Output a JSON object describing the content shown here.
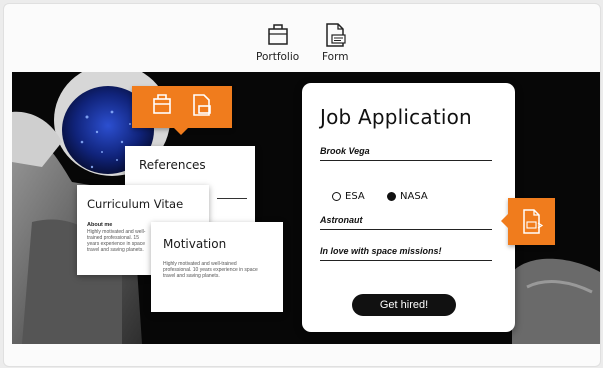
{
  "toolbar": {
    "portfolio_label": "Portfolio",
    "form_label": "Form"
  },
  "references": {
    "title": "References"
  },
  "cv": {
    "title": "Curriculum Vitae",
    "about_heading": "About me",
    "about_text": "Highly motivated and well-trained professional. 15 years experience in space travel and saving planets."
  },
  "motivation": {
    "title": "Motivation",
    "text": "Highly motivated and well-trained professional. 10 years experience in space travel and saving planets."
  },
  "job_form": {
    "title": "Job Application",
    "name_value": "Brook Vega",
    "agency_options": [
      "ESA",
      "NASA"
    ],
    "agency_selected": "NASA",
    "role_value": "Astronaut",
    "motivation_value": "In love with space missions!",
    "submit_label": "Get hired!"
  },
  "colors": {
    "accent": "#f07c1d",
    "stage_bg": "#070707"
  },
  "icons": {
    "portfolio": "portfolio-briefcase-icon",
    "form": "form-document-icon",
    "pdf": "pdf-document-icon"
  }
}
